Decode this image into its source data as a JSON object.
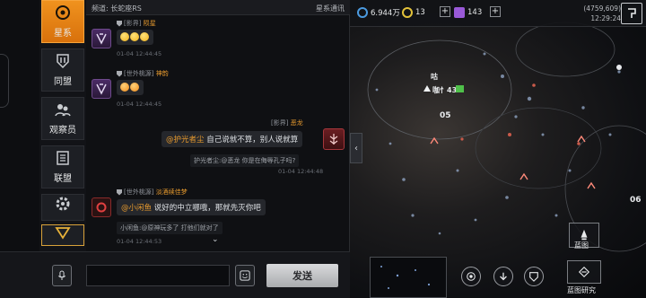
{
  "sidebar": {
    "items": [
      {
        "label": "星系",
        "icon": "galaxy-icon",
        "active": true
      },
      {
        "label": "同盟",
        "icon": "alliance-icon",
        "active": false
      },
      {
        "label": "观察员",
        "icon": "observer-icon",
        "active": false
      },
      {
        "label": "联盟",
        "icon": "league-icon",
        "active": false
      }
    ]
  },
  "chat": {
    "header_left": "频道: 长蛇座RS",
    "header_right": "星系通讯",
    "messages": [
      {
        "tag": "[影界]",
        "nick": "陨星",
        "time": "01-04 12:44:45",
        "content_type": "emoji"
      },
      {
        "tag": "[世外桃源]",
        "nick": "神韵",
        "time": "01-04 12:44:45",
        "content_type": "emoji"
      },
      {
        "tag": "[影界]",
        "nick": "恶龙",
        "mention": "@护光者尘",
        "text": "自己说就不算，别人说就算",
        "quote": "护光者尘:@恶龙 你是在侮辱孔子吗?",
        "time": "01-04 12:44:48"
      },
      {
        "tag": "[世外桃源]",
        "nick": "淡酒续佳梦",
        "mention": "@小闲鱼",
        "text": "说好的中立哪哦，那就先灭你吧",
        "quote": "小闲鱼:@原神玩多了 打他们就对了",
        "time": "01-04 12:44:53"
      }
    ],
    "input_value": "",
    "send_label": "发送"
  },
  "map": {
    "resources": {
      "credits": "6.944万",
      "energy": "13",
      "crystal": "143"
    },
    "coords": "(4759,609)",
    "clock": "12:29:24",
    "labels": {
      "fleet": "咕",
      "station": "咖忄43",
      "sector": "05",
      "sector2": "06"
    },
    "btn_map": "蓝图",
    "btn_research": "蓝图研究"
  },
  "colors": {
    "accent": "#f0921e",
    "mention": "#e79a2e"
  }
}
